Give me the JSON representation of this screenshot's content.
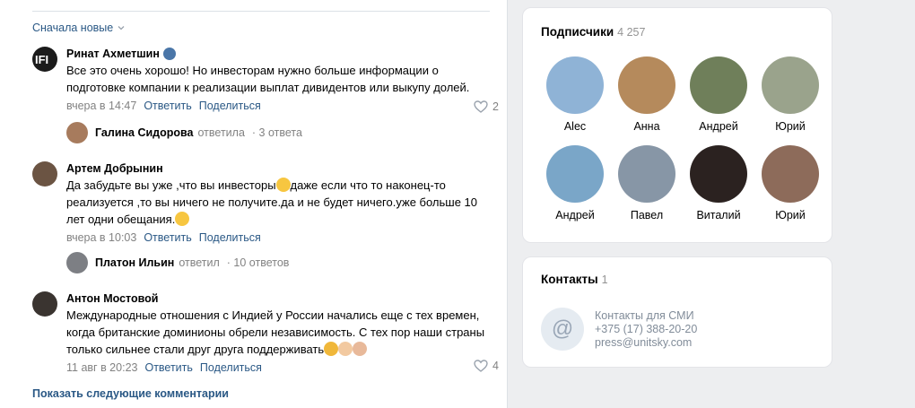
{
  "feed": {
    "sort_label": "Сначала новые",
    "show_more": "Показать следующие комментарии",
    "comments": [
      {
        "author": "Ринат Ахметшин",
        "text": "Все это очень хорошо! Но инвесторам нужно больше информации о подготовке компании к реализации выплат дивидентов или выкупу долей.",
        "time": "вчера в 14:47",
        "reply": "Ответить",
        "share": "Поделиться",
        "likes": "2",
        "thread": {
          "name": "Галина Сидорова",
          "verb": "ответила",
          "count": "· 3 ответа"
        }
      },
      {
        "author": "Артем Добрынин",
        "text_parts": [
          "Да забудьте вы уже ,что вы инвесторы",
          "даже если что то наконец-то реализуется ,то вы ничего не получите.да и не будет ничего.уже больше 10 лет одни обещания."
        ],
        "time": "вчера в 10:03",
        "reply": "Ответить",
        "share": "Поделиться",
        "thread": {
          "name": "Платон Ильин",
          "verb": "ответил",
          "count": "· 10 ответов"
        }
      },
      {
        "author": "Антон Мостовой",
        "text": "Международные отношения с Индией у России начались еще с тех времен, когда британские доминионы обрели независимость. С тех пор наши страны только сильнее стали друг друга поддерживать",
        "time": "11 авг в 20:23",
        "reply": "Ответить",
        "share": "Поделиться",
        "likes": "4"
      }
    ]
  },
  "subscribers": {
    "title": "Подписчики",
    "count": "4 257",
    "people": [
      {
        "name": "Alec",
        "color": "#8fb3d6"
      },
      {
        "name": "Анна",
        "color": "#b58a5c"
      },
      {
        "name": "Андрей",
        "color": "#6f7f5a"
      },
      {
        "name": "Юрий",
        "color": "#9aa38c"
      },
      {
        "name": "Андрей",
        "color": "#7aa6c8"
      },
      {
        "name": "Павел",
        "color": "#8796a6"
      },
      {
        "name": "Виталий",
        "color": "#2b2220"
      },
      {
        "name": "Юрий",
        "color": "#8d6b5a"
      }
    ]
  },
  "contacts": {
    "title": "Контакты",
    "count": "1",
    "label": "Контакты для СМИ",
    "phone": "+375 (17) 388-20-20",
    "email": "press@unitsky.com"
  },
  "colors": {
    "link": "#2a5885",
    "muted": "#828282",
    "bg": "#edeef0"
  }
}
